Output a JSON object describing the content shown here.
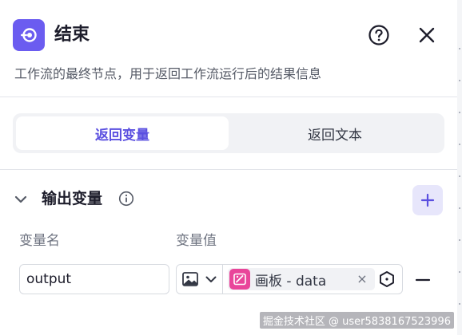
{
  "header": {
    "title": "结束",
    "description": "工作流的最终节点，用于返回工作流运行后的结果信息",
    "node_icon": "end-node-icon",
    "help_icon": "help-icon",
    "close_icon": "close-icon"
  },
  "tabs": [
    {
      "label": "返回变量",
      "active": true
    },
    {
      "label": "返回文本",
      "active": false
    }
  ],
  "output_section": {
    "title": "输出变量",
    "columns": {
      "name": "变量名",
      "value": "变量值"
    },
    "rows": [
      {
        "name": "output",
        "value_type_icon": "image-icon",
        "reference_label": "画板 - data"
      }
    ]
  },
  "watermark": "掘金技术社区 @ user5838167523996",
  "colors": {
    "accent": "#5a4fe0",
    "node_icon_bg": "#6b5cf0",
    "tag_icon_bg": "#e9459a",
    "add_button_bg": "#e7e6fb"
  }
}
